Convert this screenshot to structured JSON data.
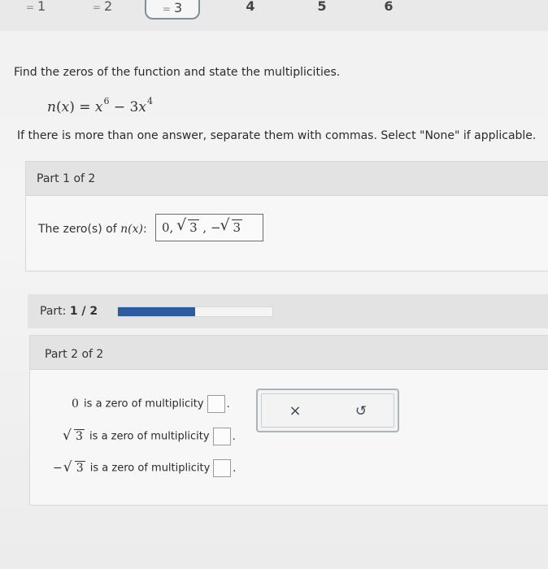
{
  "nav": {
    "tabs": [
      {
        "label": "1",
        "state": "done"
      },
      {
        "label": "2",
        "state": "done"
      },
      {
        "label": "3",
        "state": "active"
      },
      {
        "label": "4",
        "state": "plain"
      },
      {
        "label": "5",
        "state": "plain"
      },
      {
        "label": "6",
        "state": "plain"
      }
    ],
    "tab_mark": "="
  },
  "question": {
    "prompt": "Find the zeros of the function and state the multiplicities.",
    "func_name": "n",
    "func_var": "x",
    "func_rhs_term1_base": "x",
    "func_rhs_term1_exp": "6",
    "func_rhs_minus": " − ",
    "func_rhs_term2_coef": "3",
    "func_rhs_term2_base": "x",
    "func_rhs_term2_exp": "4",
    "instructions": "If there is more than one answer, separate them with commas. Select \"None\" if applicable."
  },
  "part1": {
    "header": "Part 1 of 2",
    "label_prefix": "The zero(s) of ",
    "label_func": "n",
    "label_var": "(x)",
    "label_suffix": ":",
    "answer_lead": "0, ",
    "answer_rad1": "3",
    "answer_sep": " , −",
    "answer_rad2": "3"
  },
  "progress": {
    "label_prefix": "Part: ",
    "label_value": "1 / 2",
    "fraction": 0.5
  },
  "part2": {
    "header": "Part 2 of 2",
    "rows": [
      {
        "prefix": "",
        "value": "0",
        "radicand": "",
        "text": " is a zero of multiplicity",
        "period": "."
      },
      {
        "prefix": "",
        "value": "",
        "radicand": "3",
        "text": " is a zero of multiplicity",
        "period": "."
      },
      {
        "prefix": "−",
        "value": "",
        "radicand": "3",
        "text": " is a zero of multiplicity",
        "period": "."
      }
    ]
  },
  "tools": {
    "clear_symbol": "×",
    "undo_symbol": "↺",
    "clear_icon": "close-icon",
    "undo_icon": "undo-icon"
  },
  "colors": {
    "progress_fill": "#2d5ba1",
    "toolbox_border": "#a9b5bb"
  }
}
